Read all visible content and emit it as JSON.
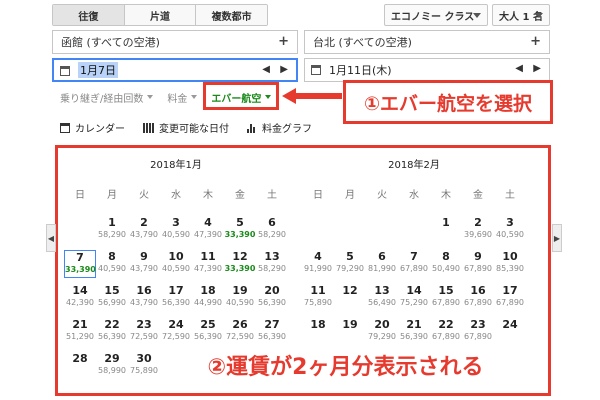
{
  "trip_tabs": [
    {
      "label": "往復",
      "active": true
    },
    {
      "label": "片道",
      "active": false
    },
    {
      "label": "複数都市",
      "active": false
    }
  ],
  "cabin_select": "エコノミー クラス",
  "passengers_select": "大人 1 名",
  "origin": {
    "value": "函館 (すべての空港)",
    "add": "+"
  },
  "destination": {
    "value": "台北 (すべての空港)",
    "add": "+"
  },
  "depart_date": "1月7日",
  "return_date": "1月11日(木)",
  "filters": {
    "stops": "乗り継ぎ/経由回数",
    "price": "料金",
    "airline": "エバー航空"
  },
  "callout_1": "①エバー航空を選択",
  "view_bar": {
    "calendar": "カレンダー",
    "flexible": "変更可能な日付",
    "price_graph": "料金グラフ"
  },
  "dow": [
    "日",
    "月",
    "火",
    "水",
    "木",
    "金",
    "土"
  ],
  "months": [
    {
      "title": "2018年1月",
      "days": [
        {
          "d": "1",
          "p": "58,290",
          "col": 1,
          "row": 0
        },
        {
          "d": "2",
          "p": "43,790",
          "col": 2,
          "row": 0
        },
        {
          "d": "3",
          "p": "40,590",
          "col": 3,
          "row": 0
        },
        {
          "d": "4",
          "p": "47,390",
          "col": 4,
          "row": 0
        },
        {
          "d": "5",
          "p": "33,390",
          "col": 5,
          "row": 0,
          "green": true
        },
        {
          "d": "6",
          "p": "58,290",
          "col": 6,
          "row": 0
        },
        {
          "d": "7",
          "p": "33,390",
          "col": 0,
          "row": 1,
          "green": true,
          "selected": true
        },
        {
          "d": "8",
          "p": "40,590",
          "col": 1,
          "row": 1
        },
        {
          "d": "9",
          "p": "43,790",
          "col": 2,
          "row": 1
        },
        {
          "d": "10",
          "p": "40,590",
          "col": 3,
          "row": 1
        },
        {
          "d": "11",
          "p": "47,390",
          "col": 4,
          "row": 1
        },
        {
          "d": "12",
          "p": "33,390",
          "col": 5,
          "row": 1,
          "green": true
        },
        {
          "d": "13",
          "p": "58,290",
          "col": 6,
          "row": 1
        },
        {
          "d": "14",
          "p": "42,390",
          "col": 0,
          "row": 2
        },
        {
          "d": "15",
          "p": "56,990",
          "col": 1,
          "row": 2
        },
        {
          "d": "16",
          "p": "43,790",
          "col": 2,
          "row": 2
        },
        {
          "d": "17",
          "p": "56,390",
          "col": 3,
          "row": 2
        },
        {
          "d": "18",
          "p": "44,990",
          "col": 4,
          "row": 2
        },
        {
          "d": "19",
          "p": "40,590",
          "col": 5,
          "row": 2
        },
        {
          "d": "20",
          "p": "56,390",
          "col": 6,
          "row": 2
        },
        {
          "d": "21",
          "p": "51,290",
          "col": 0,
          "row": 3
        },
        {
          "d": "22",
          "p": "56,390",
          "col": 1,
          "row": 3
        },
        {
          "d": "23",
          "p": "72,590",
          "col": 2,
          "row": 3
        },
        {
          "d": "24",
          "p": "72,590",
          "col": 3,
          "row": 3
        },
        {
          "d": "25",
          "p": "56,390",
          "col": 4,
          "row": 3
        },
        {
          "d": "26",
          "p": "72,590",
          "col": 5,
          "row": 3
        },
        {
          "d": "27",
          "p": "56,390",
          "col": 6,
          "row": 3
        },
        {
          "d": "28",
          "p": "",
          "col": 0,
          "row": 4
        },
        {
          "d": "29",
          "p": "58,990",
          "col": 1,
          "row": 4
        },
        {
          "d": "30",
          "p": "75,890",
          "col": 2,
          "row": 4
        },
        {
          "d": "31",
          "p": "",
          "col": 3,
          "row": 4
        }
      ]
    },
    {
      "title": "2018年2月",
      "days": [
        {
          "d": "1",
          "p": "",
          "col": 4,
          "row": 0
        },
        {
          "d": "2",
          "p": "39,690",
          "col": 5,
          "row": 0
        },
        {
          "d": "3",
          "p": "40,590",
          "col": 6,
          "row": 0
        },
        {
          "d": "4",
          "p": "91,990",
          "col": 0,
          "row": 1
        },
        {
          "d": "5",
          "p": "79,290",
          "col": 1,
          "row": 1
        },
        {
          "d": "6",
          "p": "81,990",
          "col": 2,
          "row": 1
        },
        {
          "d": "7",
          "p": "67,890",
          "col": 3,
          "row": 1
        },
        {
          "d": "8",
          "p": "50,490",
          "col": 4,
          "row": 1
        },
        {
          "d": "9",
          "p": "67,890",
          "col": 5,
          "row": 1
        },
        {
          "d": "10",
          "p": "85,390",
          "col": 6,
          "row": 1
        },
        {
          "d": "11",
          "p": "75,890",
          "col": 0,
          "row": 2
        },
        {
          "d": "12",
          "p": "",
          "col": 1,
          "row": 2
        },
        {
          "d": "13",
          "p": "56,490",
          "col": 2,
          "row": 2
        },
        {
          "d": "14",
          "p": "75,290",
          "col": 3,
          "row": 2
        },
        {
          "d": "15",
          "p": "67,890",
          "col": 4,
          "row": 2
        },
        {
          "d": "16",
          "p": "67,890",
          "col": 5,
          "row": 2
        },
        {
          "d": "17",
          "p": "67,890",
          "col": 6,
          "row": 2
        },
        {
          "d": "18",
          "p": "",
          "col": 0,
          "row": 3
        },
        {
          "d": "19",
          "p": "",
          "col": 1,
          "row": 3
        },
        {
          "d": "20",
          "p": "79,290",
          "col": 2,
          "row": 3
        },
        {
          "d": "21",
          "p": "56,390",
          "col": 3,
          "row": 3
        },
        {
          "d": "22",
          "p": "67,890",
          "col": 4,
          "row": 3
        },
        {
          "d": "23",
          "p": "67,890",
          "col": 5,
          "row": 3
        },
        {
          "d": "24",
          "p": "",
          "col": 6,
          "row": 3
        }
      ]
    }
  ],
  "callout_2": "②運賃が2ヶ月分表示される"
}
